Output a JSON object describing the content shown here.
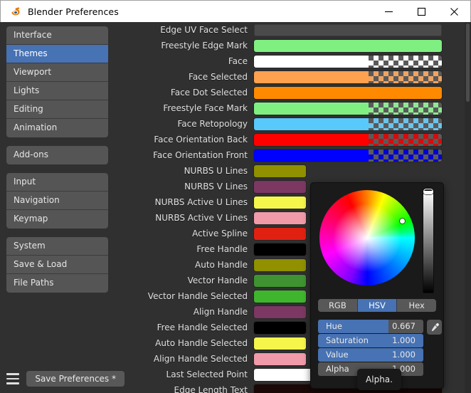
{
  "window": {
    "title": "Blender Preferences",
    "logo_icon": "blender-logo-icon",
    "minimize_label": "Minimize",
    "maximize_label": "Maximize",
    "close_label": "Close"
  },
  "nav": {
    "groups": [
      {
        "items": [
          {
            "label": "Interface",
            "active": false
          },
          {
            "label": "Themes",
            "active": true
          },
          {
            "label": "Viewport",
            "active": false
          },
          {
            "label": "Lights",
            "active": false
          },
          {
            "label": "Editing",
            "active": false
          },
          {
            "label": "Animation",
            "active": false
          }
        ]
      },
      {
        "items": [
          {
            "label": "Add-ons",
            "active": false
          }
        ]
      },
      {
        "items": [
          {
            "label": "Input",
            "active": false
          },
          {
            "label": "Navigation",
            "active": false
          },
          {
            "label": "Keymap",
            "active": false
          }
        ]
      },
      {
        "items": [
          {
            "label": "System",
            "active": false
          },
          {
            "label": "Save & Load",
            "active": false
          },
          {
            "label": "File Paths",
            "active": false
          }
        ]
      }
    ]
  },
  "bottom_bar": {
    "menu_icon": "hamburger-menu-icon",
    "save_label": "Save Preferences *"
  },
  "theme_rows": [
    {
      "label": "Edge UV Face Select",
      "color": "#4a4a4a",
      "alpha": 1,
      "empty": true
    },
    {
      "label": "Freestyle Edge Mark",
      "color": "#7fef82",
      "alpha": 1
    },
    {
      "label": "Face",
      "color": "#ffffff",
      "alpha": 0.61
    },
    {
      "label": "Face Selected",
      "color": "#ffa14f",
      "alpha": 0.61
    },
    {
      "label": "Face Dot Selected",
      "color": "#ff8a00",
      "alpha": 1
    },
    {
      "label": "Freestyle Face Mark",
      "color": "#7fef82",
      "alpha": 0.61
    },
    {
      "label": "Face Retopology",
      "color": "#59c8fa",
      "alpha": 0.61
    },
    {
      "label": "Face Orientation Back",
      "color": "#ff0000",
      "alpha": 0.61
    },
    {
      "label": "Face Orientation Front",
      "color": "#0000ff",
      "alpha": 0.61
    },
    {
      "label": "NURBS U Lines",
      "color": "#909000",
      "alpha": 1,
      "narrow": true
    },
    {
      "label": "NURBS V Lines",
      "color": "#7c3763",
      "alpha": 1,
      "narrow": true
    },
    {
      "label": "NURBS Active U Lines",
      "color": "#f5f54c",
      "alpha": 1,
      "narrow": true
    },
    {
      "label": "NURBS Active V Lines",
      "color": "#f09aaa",
      "alpha": 1,
      "narrow": true
    },
    {
      "label": "Active Spline",
      "color": "#e02112",
      "alpha": 1,
      "narrow": true
    },
    {
      "label": "Free Handle",
      "color": "#000000",
      "alpha": 1,
      "narrow": true
    },
    {
      "label": "Auto Handle",
      "color": "#909000",
      "alpha": 1,
      "narrow": true
    },
    {
      "label": "Vector Handle",
      "color": "#3f9331",
      "alpha": 1,
      "narrow": true
    },
    {
      "label": "Vector Handle Selected",
      "color": "#3fb52e",
      "alpha": 1,
      "narrow": true
    },
    {
      "label": "Align Handle",
      "color": "#7c3763",
      "alpha": 1,
      "narrow": true
    },
    {
      "label": "Free Handle Selected",
      "color": "#000000",
      "alpha": 1,
      "narrow": true
    },
    {
      "label": "Auto Handle Selected",
      "color": "#f5f54c",
      "alpha": 1,
      "narrow": true
    },
    {
      "label": "Align Handle Selected",
      "color": "#f09aaa",
      "alpha": 1,
      "narrow": true
    },
    {
      "label": "Last Selected Point",
      "color": "#ffffff",
      "alpha": 1
    },
    {
      "label": "Edge Length Text",
      "color": "#1a0807",
      "alpha": 1
    }
  ],
  "color_picker": {
    "wheel_icon": "color-wheel",
    "value_slider_icon": "value-slider",
    "modes": [
      {
        "label": "RGB",
        "active": false
      },
      {
        "label": "HSV",
        "active": true
      },
      {
        "label": "Hex",
        "active": false
      }
    ],
    "sliders": [
      {
        "name": "Hue",
        "value": "0.667",
        "fill": 0.667
      },
      {
        "name": "Saturation",
        "value": "1.000",
        "fill": 1.0
      },
      {
        "name": "Value",
        "value": "1.000",
        "fill": 1.0
      },
      {
        "name": "Alpha",
        "value": "1.000",
        "fill": 0.0
      }
    ],
    "eyedropper_icon": "eyedropper-icon",
    "tooltip_text": "Alpha."
  },
  "colors": {
    "accent_blue": "#4772b3",
    "panel_bg": "#303030",
    "popup_bg": "#1a1a1a",
    "widget_gray": "#555555"
  }
}
